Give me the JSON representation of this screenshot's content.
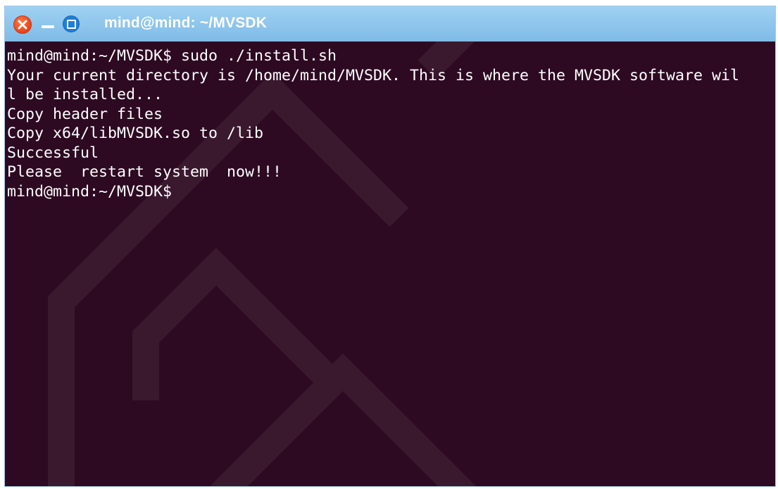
{
  "window": {
    "title": "mind@mind: ~/MVSDK"
  },
  "titlebar_buttons": {
    "close_icon": "close-icon",
    "minimize_icon": "minimize-icon",
    "maximize_icon": "maximize-icon"
  },
  "terminal": {
    "lines": [
      "mind@mind:~/MVSDK$ sudo ./install.sh",
      "Your current directory is /home/mind/MVSDK. This is where the MVSDK software wil",
      "l be installed...",
      "Copy header files",
      "Copy x64/libMVSDK.so to /lib",
      "Successful",
      "Please  restart system  now!!!",
      "mind@mind:~/MVSDK$"
    ]
  },
  "colors": {
    "terminal_background": "#2d0a22",
    "titlebar": "#8cc6ee",
    "close_button": "#e5451a",
    "maximize_button": "#1f7fd6",
    "text": "#ffffff"
  }
}
